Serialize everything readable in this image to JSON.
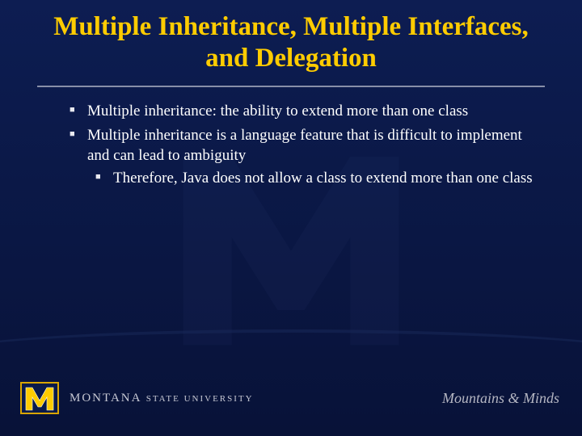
{
  "title": "Multiple Inheritance, Multiple Interfaces, and Delegation",
  "bullets": {
    "b1": "Multiple inheritance: the ability to extend more than one class",
    "b2": "Multiple inheritance is a language feature that is difficult to implement and can lead to ambiguity",
    "b2_sub1": "Therefore, Java does not allow a class to extend more than one class"
  },
  "footer": {
    "university_l1": "MONTANA",
    "university_l2": "STATE UNIVERSITY",
    "tagline_pre": "Mountains",
    "tagline_amp": "&",
    "tagline_post": "Minds"
  }
}
